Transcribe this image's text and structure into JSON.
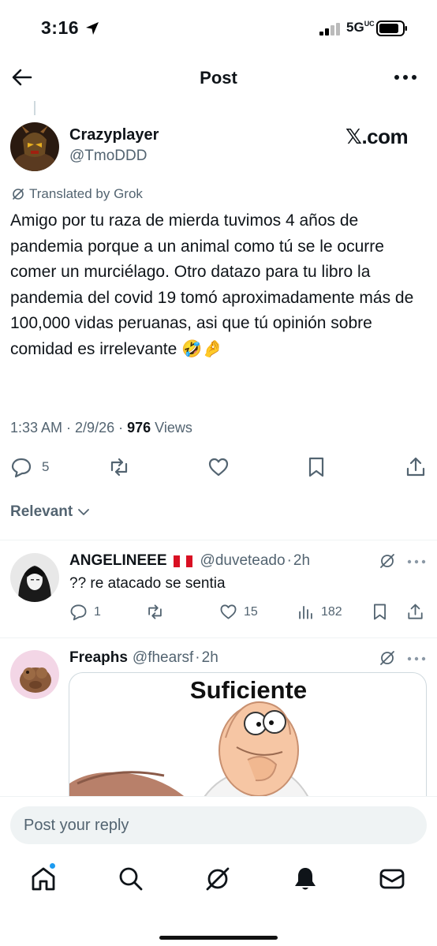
{
  "status": {
    "time": "3:16",
    "network": "5G"
  },
  "header": {
    "title": "Post"
  },
  "post": {
    "author_name": "Crazyplayer",
    "author_handle": "@TmoDDD",
    "brand": "𝕏.com",
    "translated_label": "Translated by Grok",
    "text": "Amigo por tu raza de mierda tuvimos 4 años de pandemia porque a un animal como tú se le ocurre comer un murciélago. Otro datazo para tu libro la pandemia del covid 19 tomó aproximadamente más de 100,000 vidas peruanas, asi que tú opinión sobre comidad es irrelevante 🤣🤌",
    "time": "1:33 AM",
    "date": "2/9/26",
    "views": "976",
    "views_label": "Views",
    "reply_count": "5"
  },
  "sort": {
    "label": "Relevant"
  },
  "replies": [
    {
      "name": "ANGELINEEE",
      "handle": "@duveteado",
      "age": "2h",
      "text": "?? re atacado se sentia",
      "replies": "1",
      "likes": "15",
      "views": "182"
    },
    {
      "name": "Freaphs",
      "handle": "@fhearsf",
      "age": "2h",
      "media_caption": "Suficiente"
    }
  ],
  "composer": {
    "placeholder": "Post your reply"
  },
  "colors": {
    "accent": "#1d9bf0",
    "text": "#0f1419",
    "secondary": "#536471",
    "divider": "#eff3f4"
  },
  "icons": [
    "location-arrow-icon",
    "signal-icon",
    "battery-icon",
    "back-arrow-icon",
    "more-icon",
    "grok-icon",
    "reply-icon",
    "repost-icon",
    "like-icon",
    "bookmark-icon",
    "share-icon",
    "views-icon",
    "home-icon",
    "search-icon",
    "notifications-icon",
    "messages-icon"
  ]
}
